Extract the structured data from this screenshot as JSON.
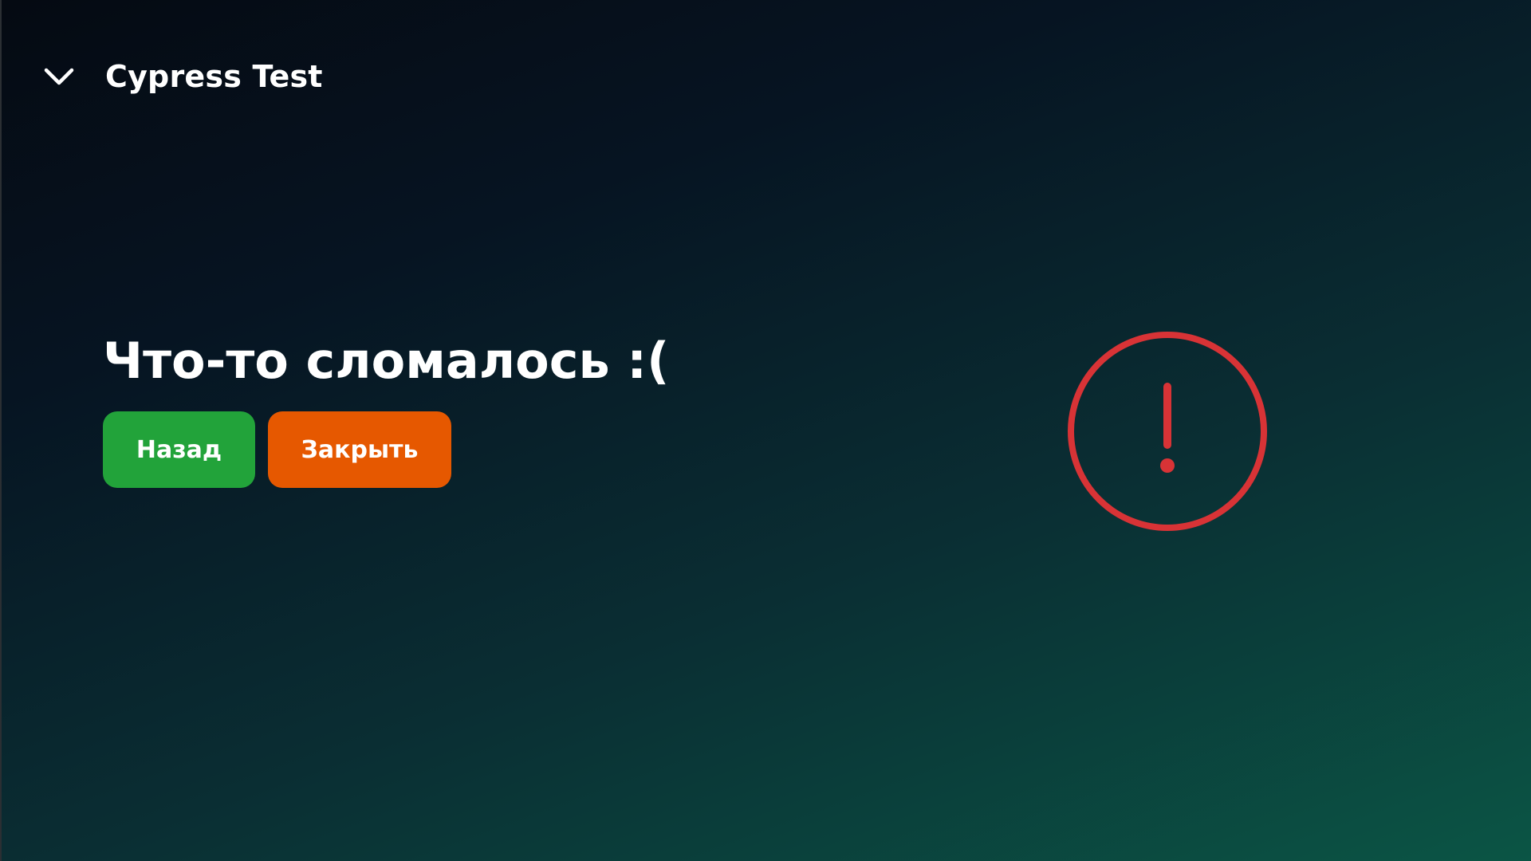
{
  "header": {
    "title": "Cypress Test",
    "back_icon": "chevron-down-icon"
  },
  "error": {
    "title": "Что-то сломалось :(",
    "icon": "alert-circle-icon"
  },
  "actions": {
    "back_label": "Назад",
    "close_label": "Закрыть"
  },
  "colors": {
    "back_button": "#22a33a",
    "close_button": "#e65800",
    "alert_icon": "#d83336"
  }
}
